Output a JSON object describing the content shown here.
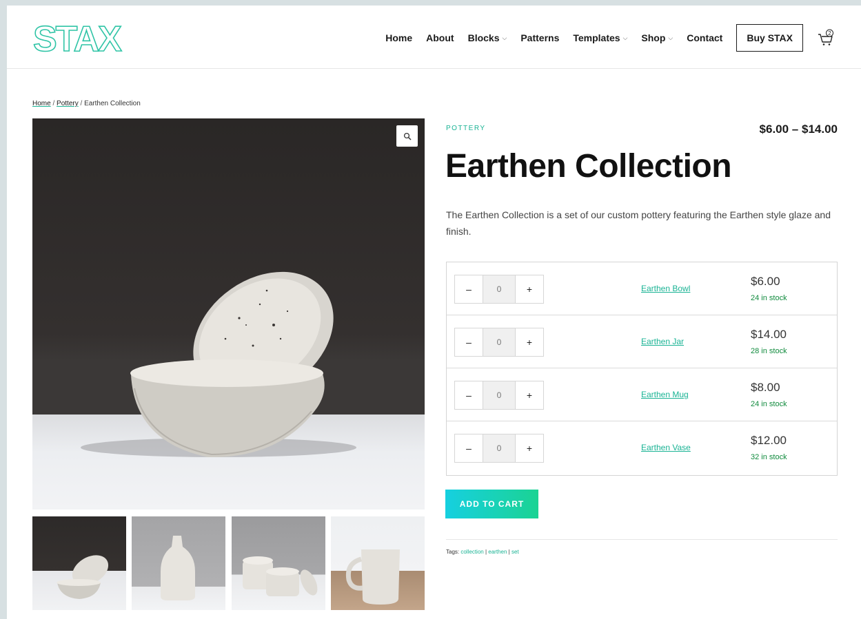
{
  "brand": {
    "logo_text": "STAX",
    "accent": "#19b394"
  },
  "nav": {
    "items": [
      {
        "label": "Home",
        "has_dropdown": false
      },
      {
        "label": "About",
        "has_dropdown": false
      },
      {
        "label": "Blocks",
        "has_dropdown": true
      },
      {
        "label": "Patterns",
        "has_dropdown": false
      },
      {
        "label": "Templates",
        "has_dropdown": true
      },
      {
        "label": "Shop",
        "has_dropdown": true
      },
      {
        "label": "Contact",
        "has_dropdown": false
      }
    ],
    "cta_label": "Buy STAX",
    "cart_count": "2",
    "dropdown_icon": "chevron-down-icon"
  },
  "breadcrumb": {
    "home": "Home",
    "category": "Pottery",
    "current": "Earthen Collection",
    "separator": "/"
  },
  "product": {
    "category": "POTTERY",
    "price_range": "$6.00 – $14.00",
    "title": "Earthen Collection",
    "description": "The Earthen Collection is a set of our custom pottery featuring the Earthen style glaze and finish.",
    "items": [
      {
        "name": "Earthen Bowl",
        "qty": "0",
        "price": "$6.00",
        "stock": "24 in stock"
      },
      {
        "name": "Earthen Jar",
        "qty": "0",
        "price": "$14.00",
        "stock": "28 in stock"
      },
      {
        "name": "Earthen Mug",
        "qty": "0",
        "price": "$8.00",
        "stock": "24 in stock"
      },
      {
        "name": "Earthen Vase",
        "qty": "0",
        "price": "$12.00",
        "stock": "32 in stock"
      }
    ],
    "minus_label": "–",
    "plus_label": "+",
    "add_to_cart": "ADD TO CART",
    "tags_label": "Tags:",
    "tags": [
      "collection",
      "earthen",
      "set"
    ],
    "tag_separator": "|"
  },
  "icons": {
    "zoom": "magnifier-icon",
    "cart": "cart-icon"
  }
}
